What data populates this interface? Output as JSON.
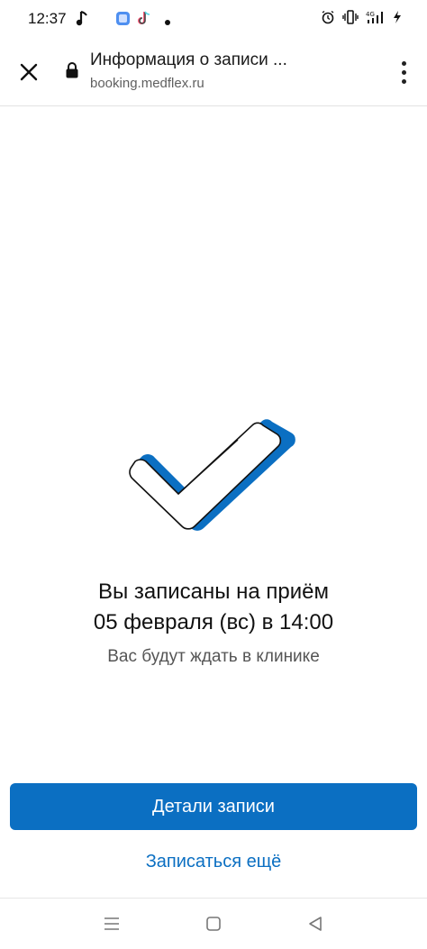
{
  "status_bar": {
    "time": "12:37",
    "icons_left": [
      "music-note-icon",
      "app-icon",
      "tiktok-icon",
      "dot-icon"
    ],
    "icons_right": [
      "alarm-icon",
      "vibrate-icon",
      "signal-4g-icon",
      "charging-icon"
    ]
  },
  "browser": {
    "title": "Информация о записи ...",
    "url": "booking.medflex.ru"
  },
  "confirmation": {
    "line1": "Вы записаны на приём",
    "line2": "05 февраля (вс) в 14:00",
    "subtitle": "Вас будут ждать в клинике"
  },
  "actions": {
    "details_label": "Детали записи",
    "book_more_label": "Записаться ещё"
  },
  "colors": {
    "accent": "#0b6fc2"
  }
}
